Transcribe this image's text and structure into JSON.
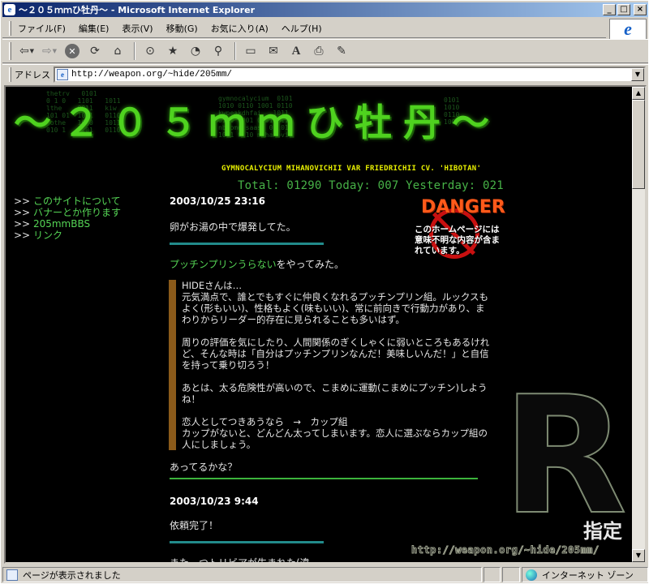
{
  "window": {
    "title": "～２０５ｍｍひ牡丹～ - Microsoft Internet Explorer",
    "controls": [
      "_",
      "□",
      "×"
    ]
  },
  "menubar": {
    "items": [
      "ファイル(F)",
      "編集(E)",
      "表示(V)",
      "移動(G)",
      "お気に入り(A)",
      "ヘルプ(H)"
    ]
  },
  "toolbar": {
    "icons": [
      "back-icon",
      "forward-icon",
      "stop-icon",
      "refresh-icon",
      "home-icon",
      "search-icon",
      "favorites-icon",
      "history-icon",
      "channels-icon",
      "fullscreen-icon",
      "mail-icon",
      "font-icon",
      "print-icon",
      "edit-icon"
    ]
  },
  "addressbar": {
    "label": "アドレス",
    "url": "http://weapon.org/~hide/205mm/"
  },
  "page": {
    "banner_title": "～２０５ｍｍひ牡丹～",
    "banner_subtitle": "GYMNOCALYCIUM MIHANOVICHII VAR FRIEDRICHII CV. 'HIBOTAN'",
    "counter": "Total: 01290 Today: 007 Yesterday: 021",
    "nav": [
      {
        "arrow": ">>",
        "label": "このサイトについて"
      },
      {
        "arrow": ">>",
        "label": "バナーとか作ります"
      },
      {
        "arrow": ">>",
        "label": "205mmBBS"
      },
      {
        "arrow": ">>",
        "label": "リンク"
      }
    ],
    "entry1": {
      "date": "2003/10/25 23:16",
      "text": "卵がお湯の中で爆発してた。",
      "link": "プッチンプリンうらない",
      "link_suffix": "をやってみた。",
      "quote": [
        "HIDEさんは…\n元気満点で、誰とでもすぐに仲良くなれるプッチンプリン組。ルックスもよく(形もいい)、性格もよく(味もいい)、常に前向きで行動力があり、まわりからリーダー的存在に見られることも多いはず。",
        "周りの評価を気にしたり、人間関係のぎくしゃくに弱いところもあるけれど、そんな時は「自分はプッチンプリンなんだ！美味しいんだ！」と自信を持って乗り切ろう！",
        "あとは、太る危険性が高いので、こまめに運動(こまめにプッチン)しようね！",
        "恋人としてつきあうなら　→　カップ組\nカップがないと、どんどん太ってしまいます。恋人に選ぶならカップ組の人にしましょう。"
      ],
      "after": "あってるかな？"
    },
    "entry2": {
      "date": "2003/10/23 9:44",
      "text": "依頼完了！",
      "next": "また一つトリビアが生まれた(違"
    },
    "danger_badge": {
      "title": "DANGER",
      "text": "このホームページには意味不明な内容が含まれています。"
    },
    "r_badge": {
      "letter": "R",
      "kanji": "指定",
      "url": "http://weapon.org/~hide/205mm/"
    }
  },
  "statusbar": {
    "text": "ページが表示されました",
    "zone": "インターネット ゾーン"
  },
  "colors": {
    "title_start": "#0a246a",
    "title_end": "#a6caf0",
    "page_bg": "#000000",
    "link_green": "#55d455",
    "banner_green": "#4fd21f",
    "divider_teal": "#228b8b",
    "quote_bar": "#8a5a1a"
  }
}
